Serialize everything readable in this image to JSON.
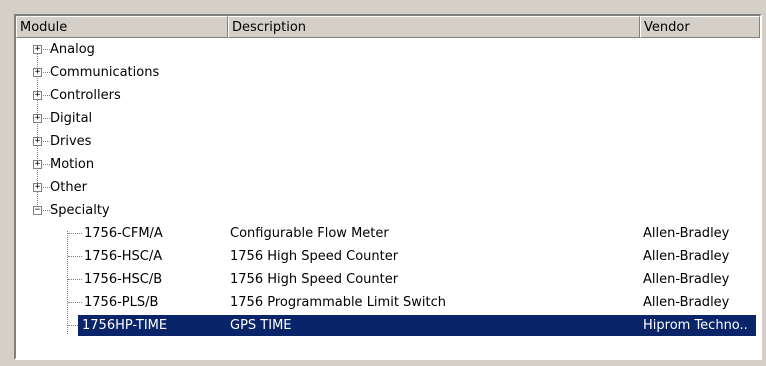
{
  "header": {
    "module": "Module",
    "description": "Description",
    "vendor": "Vendor"
  },
  "categories": [
    {
      "label": "Analog",
      "state": "+"
    },
    {
      "label": "Communications",
      "state": "+"
    },
    {
      "label": "Controllers",
      "state": "+"
    },
    {
      "label": "Digital",
      "state": "+"
    },
    {
      "label": "Drives",
      "state": "+"
    },
    {
      "label": "Motion",
      "state": "+"
    },
    {
      "label": "Other",
      "state": "+"
    },
    {
      "label": "Specialty",
      "state": "−"
    }
  ],
  "specialty_modules": [
    {
      "module": "1756-CFM/A",
      "description": "Configurable Flow Meter",
      "vendor": "Allen-Bradley",
      "selected": false
    },
    {
      "module": "1756-HSC/A",
      "description": "1756 High Speed Counter",
      "vendor": "Allen-Bradley",
      "selected": false
    },
    {
      "module": "1756-HSC/B",
      "description": "1756 High Speed Counter",
      "vendor": "Allen-Bradley",
      "selected": false
    },
    {
      "module": "1756-PLS/B",
      "description": "1756 Programmable Limit Switch",
      "vendor": "Allen-Bradley",
      "selected": false
    },
    {
      "module": "1756HP-TIME",
      "description": "GPS TIME",
      "vendor": "Hiprom Techno..",
      "selected": true
    }
  ],
  "colors": {
    "selection": "#0a246a",
    "header_bg": "#d4d0c8"
  }
}
